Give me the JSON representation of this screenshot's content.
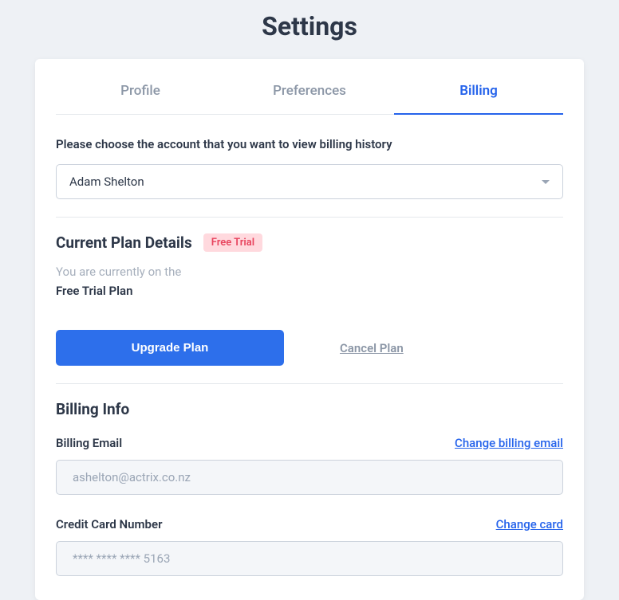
{
  "page": {
    "title": "Settings"
  },
  "tabs": {
    "profile": "Profile",
    "preferences": "Preferences",
    "billing": "Billing"
  },
  "account_select": {
    "instruction": "Please choose the account that you want to view billing history",
    "selected": "Adam Shelton"
  },
  "plan": {
    "heading": "Current Plan Details",
    "badge": "Free Trial",
    "line1": "You are currently on the",
    "line2": "Free Trial Plan",
    "upgrade_label": "Upgrade Plan",
    "cancel_label": "Cancel Plan"
  },
  "billing_info": {
    "heading": "Billing Info",
    "email_label": "Billing Email",
    "change_email_label": "Change billing email",
    "email_value": "ashelton@actrix.co.nz",
    "card_label": "Credit Card Number",
    "change_card_label": "Change card",
    "card_value": "**** **** **** 5163"
  }
}
